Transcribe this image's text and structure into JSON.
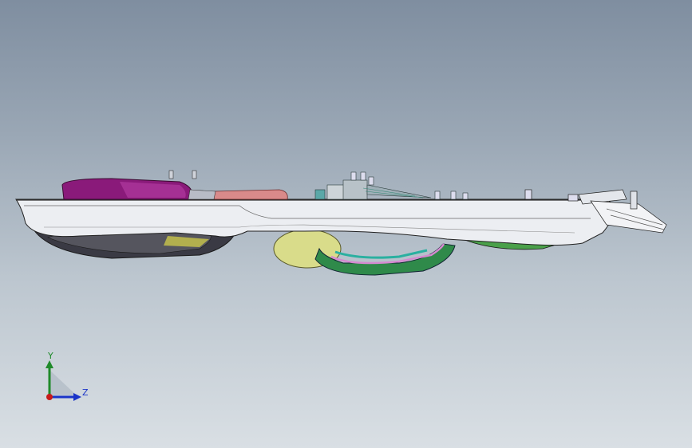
{
  "viewport": {
    "background_top": "#7f8ea0",
    "background_bottom": "#d9dfe4"
  },
  "model": {
    "view": "side elevation",
    "part_colors": {
      "housing": "#e9ebf0",
      "magenta_cover": "#8a1a7a",
      "pink_part": "#d98a8a",
      "yellow_dome": "#d9dc8a",
      "teal_tube": "#2a9a8a",
      "green_rim": "#3a9a3a",
      "dark_underside": "#2c2c34"
    }
  },
  "triad": {
    "y_label": "Y",
    "z_label": "Z",
    "y_color": "#1f8a2a",
    "z_color": "#1a34c8",
    "x_color": "#c81a1a"
  }
}
